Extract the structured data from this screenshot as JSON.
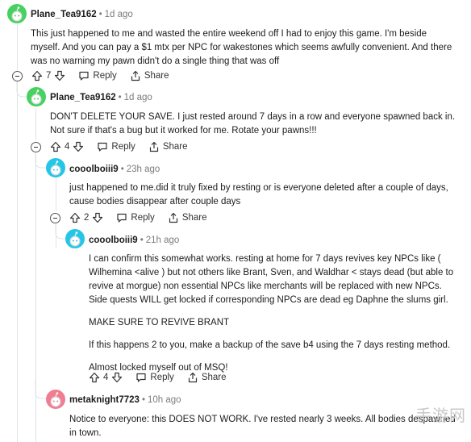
{
  "comments": [
    {
      "user": "Plane_Tea9162",
      "time": "1d ago",
      "avatar_color": "#46d160",
      "paragraphs": [
        "This just happened to me and wasted the entire weekend off I had to enjoy this game. I'm beside myself. And you can pay a $1 mtx per NPC for wakestones which seems awfully convenient. And there was no warning my pawn didn't do a single thing that was off"
      ],
      "votes": "7",
      "reply": "Reply",
      "share": "Share"
    },
    {
      "user": "Plane_Tea9162",
      "time": "1d ago",
      "avatar_color": "#46d160",
      "paragraphs": [
        "DON'T DELETE YOUR SAVE. I just rested around 7 days in a row and everyone spawned back in. Not sure if that's a bug but it worked for me. Rotate your pawns!!!"
      ],
      "votes": "4",
      "reply": "Reply",
      "share": "Share"
    },
    {
      "user": "cooolboiii9",
      "time": "23h ago",
      "avatar_color": "#24c6e8",
      "paragraphs": [
        "just happened to me.did it truly fixed by resting or is everyone deleted after a couple of days, cause bodies disappear after couple days"
      ],
      "votes": "2",
      "reply": "Reply",
      "share": "Share"
    },
    {
      "user": "cooolboiii9",
      "time": "21h ago",
      "avatar_color": "#24c6e8",
      "paragraphs": [
        "I can confirm this somewhat works. resting at home for 7 days revives key NPCs like ( Wilhemina <alive ) but not others like Brant, Sven, and Waldhar < stays dead (but able to revive at morgue) non essential NPCs like merchants will be replaced with new NPCs. Side quests WILL get locked if corresponding NPCs are dead eg Daphne the slums girl.",
        "MAKE SURE TO REVIVE BRANT",
        "If this happens 2 to you, make a backup of the save b4 using the 7 days resting method.",
        "Almost locked myself out of MSQ!"
      ],
      "votes": "4",
      "reply": "Reply",
      "share": "Share"
    },
    {
      "user": "metaknight7723",
      "time": "10h ago",
      "avatar_color": "#f07d92",
      "paragraphs": [
        "Notice to everyone: this DOES NOT WORK. I've rested nearly 3 weeks. All bodies despawned ",
        "in town."
      ]
    }
  ],
  "watermark": "手游网"
}
